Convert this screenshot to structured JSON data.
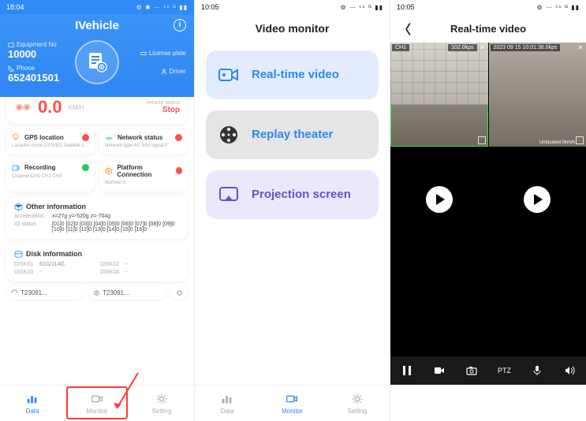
{
  "phone1": {
    "status_time": "18:04",
    "app_title": "IVehicle",
    "equip_label": "Equipment No",
    "equip_value": "10000",
    "phone_label": "Phone",
    "phone_value": "652401501",
    "plate_label": "License plate",
    "driver_label": "Driver",
    "speed": "0.0",
    "speed_unit": "KM/H",
    "vehicle_status_label": "Vehicle status",
    "vehicle_status_value": "Stop",
    "gps": {
      "title": "GPS location",
      "sub": "Location mode:GPS/BD Satellite c…"
    },
    "net": {
      "title": "Network status",
      "sub": "Network type:4G  SIM signal:0"
    },
    "rec": {
      "title": "Recording",
      "sub": "Channel:CH1 CH2 CH3"
    },
    "plat": {
      "title": "Platform Connection",
      "sub": "Number:0"
    },
    "other_title": "Other information",
    "accel_label": "acceleration",
    "accel_value": "x=27g y=-520g z=-704g",
    "io_label": "IO status",
    "io_value": "[01]0 [02]0 [03]0 [04]0 [05]0 [06]0 [07]0 [08]0 [09]0 [10]0 [11]0 [12]0 [13]0 [14]0 [15]0 [16]0",
    "disk_title": "Disk information",
    "disk1_k": "DISK01",
    "disk1_v": "61G/114G",
    "disk2_k": "DISK02",
    "disk2_v": "-",
    "disk3_k": "DISK03",
    "disk3_v": "-",
    "disk4_k": "DISK04",
    "disk4_v": "-",
    "chip1": "T23091…",
    "chip2": "T23091…",
    "tabs": {
      "data": "Data",
      "monitor": "Monitor",
      "setting": "Setting"
    }
  },
  "phone2": {
    "status_time": "10:05",
    "title": "Video monitor",
    "opt1": "Real-time video",
    "opt2": "Replay theater",
    "opt3": "Projection screen",
    "tabs": {
      "data": "Data",
      "monitor": "Monitor",
      "setting": "Setting"
    }
  },
  "phone3": {
    "status_time": "10:05",
    "title": "Real-time video",
    "ch1": "CH1",
    "ch1_rate": "102.0kps",
    "ch2_ts": "2023 09 15 10:01:36.0kps",
    "unloc": "Unlocated 0km/h",
    "ptz": "PTZ"
  }
}
